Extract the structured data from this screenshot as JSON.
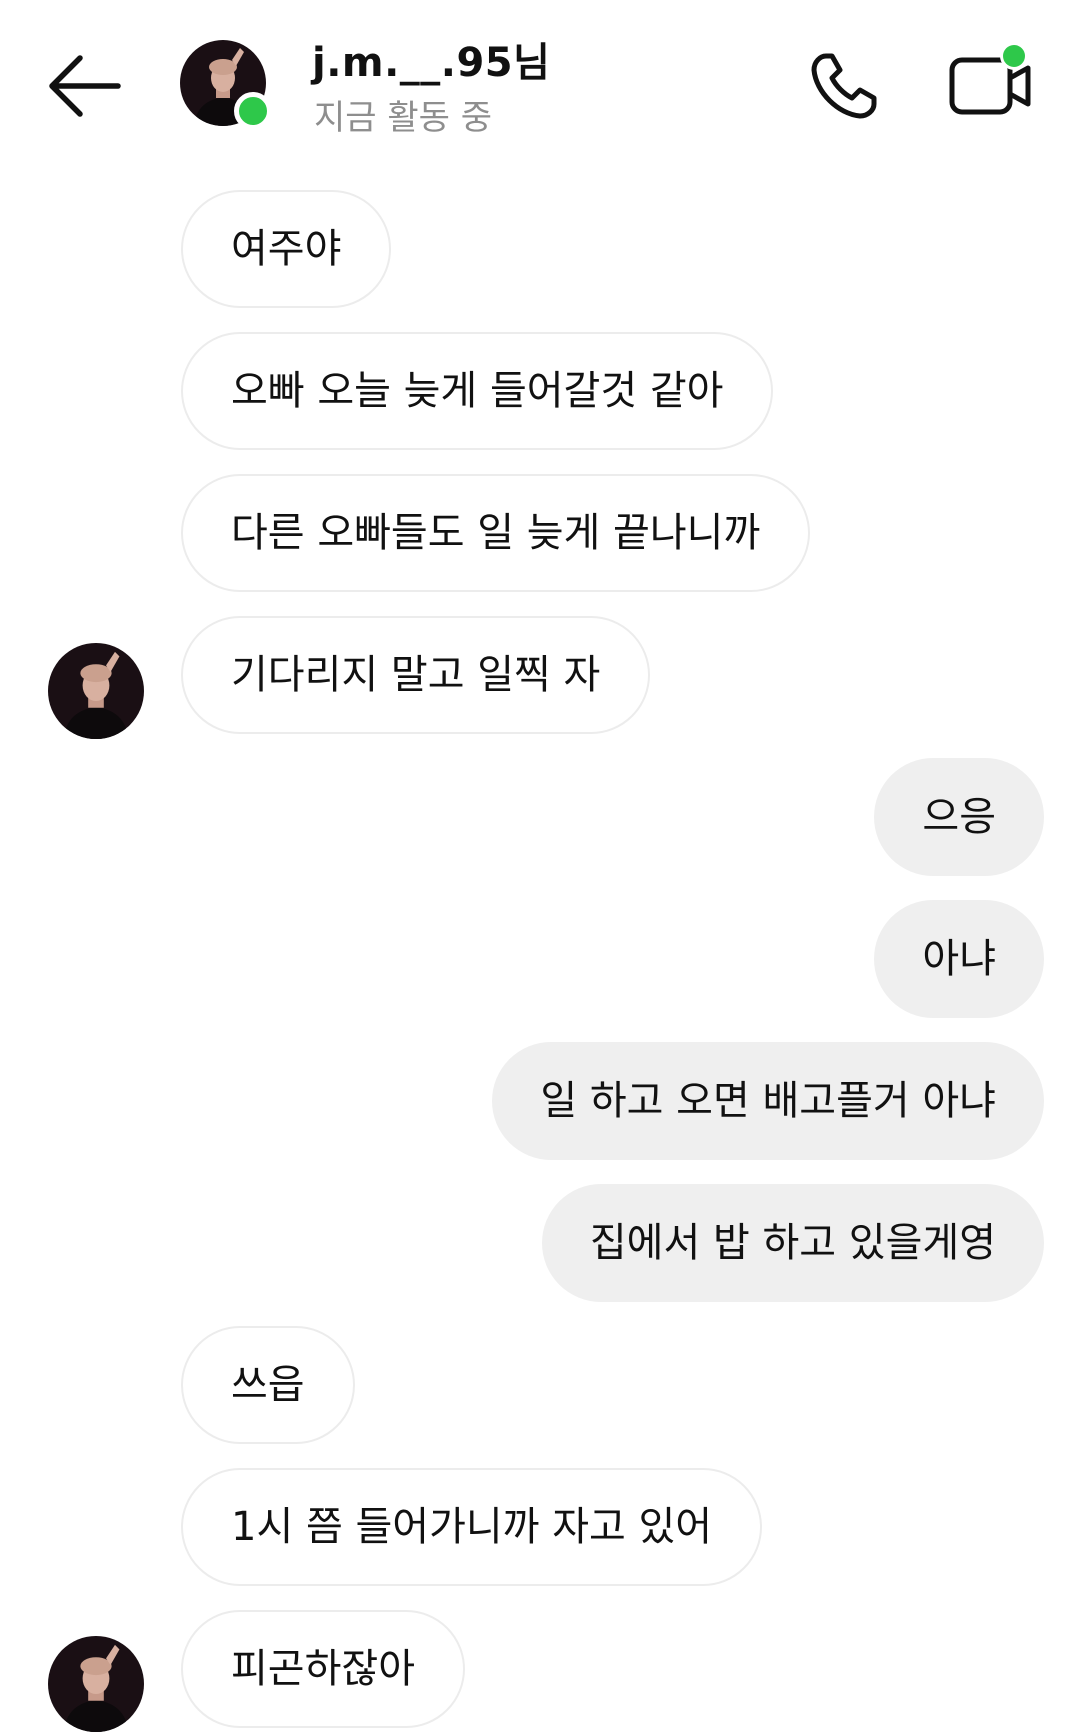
{
  "header": {
    "contact_name": "j.m.__.95님",
    "status": "지금 활동 중",
    "online_color": "#2ec84a"
  },
  "messages": [
    {
      "from": "them",
      "text": "여주야"
    },
    {
      "from": "them",
      "text": "오빠 오늘 늦게 들어갈것 같아"
    },
    {
      "from": "them",
      "text": "다른 오빠들도 일 늦게 끝나니까"
    },
    {
      "from": "them",
      "text": "기다리지 말고 일찍 자"
    },
    {
      "from": "me",
      "text": "으응"
    },
    {
      "from": "me",
      "text": "아냐"
    },
    {
      "from": "me",
      "text": "일 하고 오면 배고플거 아냐"
    },
    {
      "from": "me",
      "text": "집에서 밥 하고 있을게영"
    },
    {
      "from": "them",
      "text": "쓰읍"
    },
    {
      "from": "them",
      "text": "1시 쯤 들어가니까 자고 있어"
    },
    {
      "from": "them",
      "text": "피곤하잖아"
    }
  ],
  "colors": {
    "incoming_bubble_border": "#ececec",
    "outgoing_bubble_bg": "#efefef",
    "status_text": "#8e8e8e"
  }
}
